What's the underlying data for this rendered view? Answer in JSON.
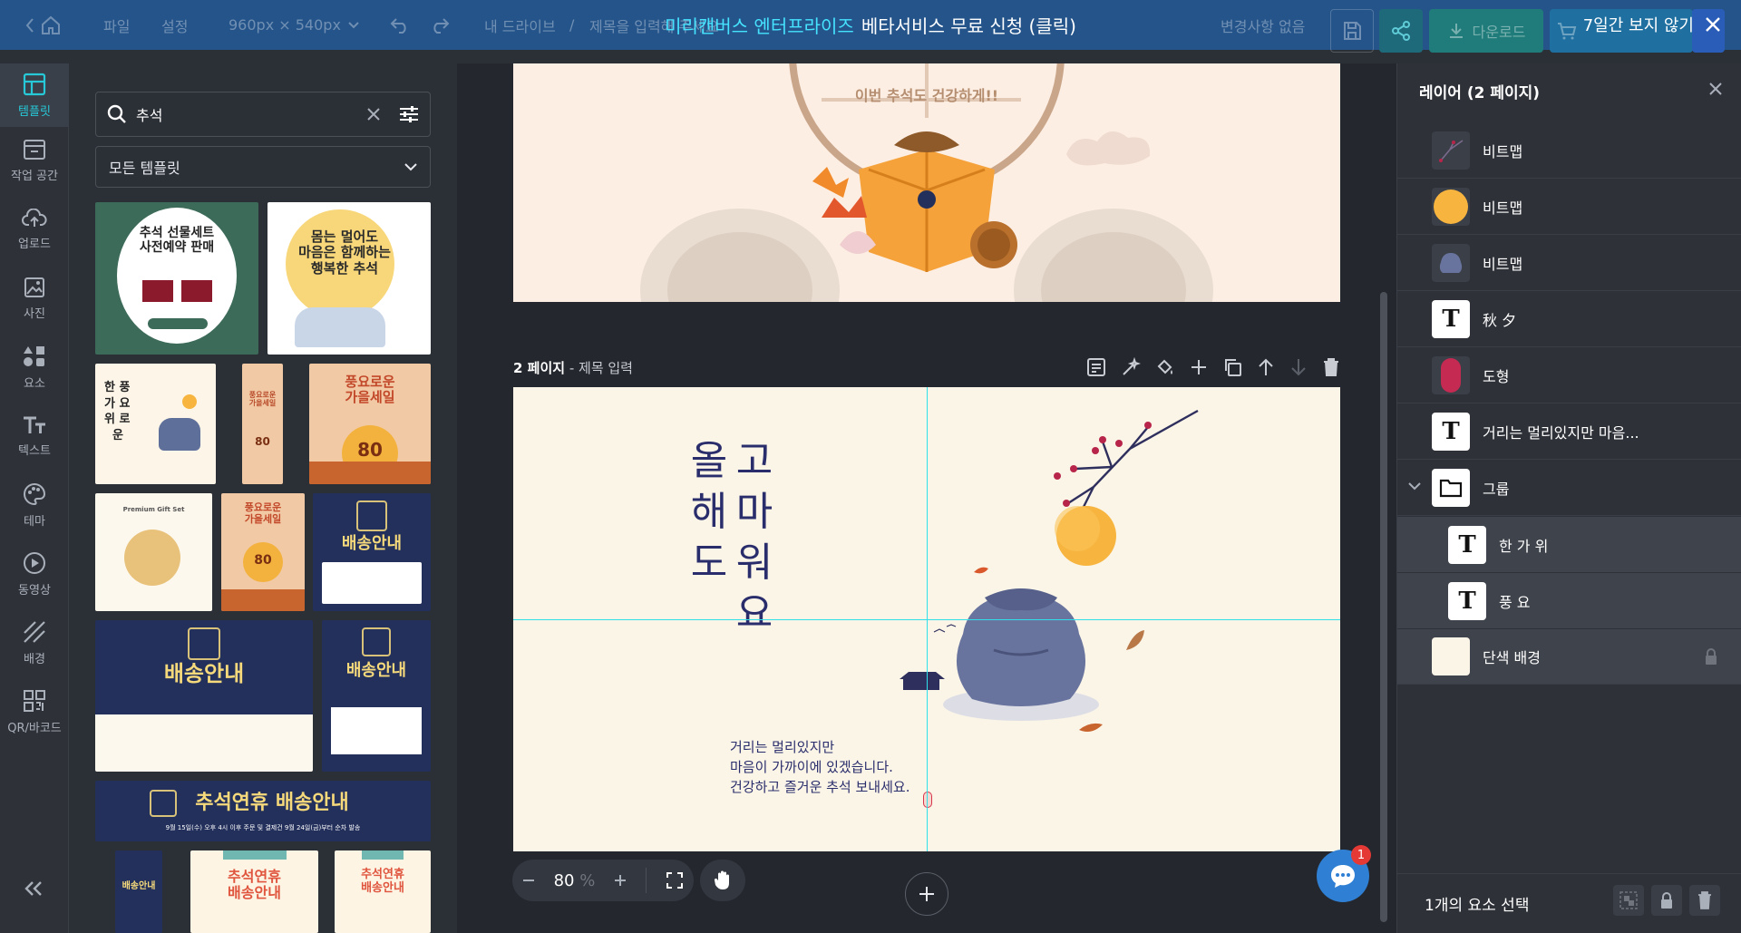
{
  "topbar": {
    "home_label": "",
    "menu_file": "파일",
    "menu_settings": "설정",
    "size": "960px × 540px",
    "breadcrumb_drive": "내 드라이브",
    "breadcrumb_sep": "/",
    "title_placeholder": "제목을 입력해 주세요",
    "no_changes": "변경사항 없음",
    "download_label": "다운로드",
    "banner_highlight": "미리캔버스 엔터프라이즈",
    "banner_text": "베타서비스 무료 신청 (클릭)",
    "banner_dismiss": "7일간 보지 않기"
  },
  "rail": [
    {
      "label": "템플릿",
      "icon": "template-icon"
    },
    {
      "label": "작업 공간",
      "icon": "workspace-icon"
    },
    {
      "label": "업로드",
      "icon": "upload-icon"
    },
    {
      "label": "사진",
      "icon": "photo-icon"
    },
    {
      "label": "요소",
      "icon": "elements-icon"
    },
    {
      "label": "텍스트",
      "icon": "text-icon"
    },
    {
      "label": "테마",
      "icon": "theme-icon"
    },
    {
      "label": "동영상",
      "icon": "video-icon"
    },
    {
      "label": "배경",
      "icon": "background-icon"
    },
    {
      "label": "QR/바코드",
      "icon": "qr-icon"
    }
  ],
  "panel": {
    "search_value": "추석",
    "filter_label": "모든 템플릿",
    "templates": {
      "t1_title": "추석 선물세트\n사전예약 판매",
      "t2_title": "몸는 멀어도\n마음은 함께하는\n행복한 추석",
      "t3_title": "한 풍\n가 요\n위 로\n  운",
      "t4_title": "풍요로운\n가을세일",
      "t4_num": "80",
      "t5_title": "풍요로운\n가을세일",
      "t5_num": "80",
      "t6_label": "Premium Gift Set",
      "t7_title": "풍요로운\n가을세일",
      "t7_num": "80",
      "t8_title": "배송안내",
      "t9_title": "배송안내",
      "t10_title": "배송안내",
      "t11_title": "추석연휴 배송안내",
      "t11_sub": "9월 15일(수) 오후 4시 이후 주문 및 결제건 9월 24일(금)부터 순차 발송",
      "t12_title": "배송안내",
      "t13_title": "추석연휴\n배송안내",
      "t14_title": "추석연휴\n배송안내"
    }
  },
  "canvas": {
    "page1_text": "이번 추석도 건강하게!!",
    "page2_label": "2 페이지",
    "page2_sep": " - ",
    "page2_title_placeholder": "제목 입력",
    "col1": [
      "올",
      "해",
      "도"
    ],
    "col2": [
      "고",
      "마",
      "워",
      "요"
    ],
    "body_line1": "거리는 멀리있지만",
    "body_line2": "마음이 가까이에 있겠습니다.",
    "body_line3": "건강하고 즐거운 추석 보내세요."
  },
  "zoom": {
    "value": "80",
    "unit": "%"
  },
  "chat_badge": "1",
  "layers": {
    "title": "레이어 (2 페이지)",
    "items": [
      {
        "name": "비트맵",
        "kind": "bitmap-branch"
      },
      {
        "name": "비트맵",
        "kind": "bitmap-moon"
      },
      {
        "name": "비트맵",
        "kind": "bitmap-bundle"
      },
      {
        "name": "秋 夕",
        "kind": "text"
      },
      {
        "name": "도형",
        "kind": "shape"
      },
      {
        "name": "거리는 멀리있지만 마음...",
        "kind": "text"
      },
      {
        "name": "그룹",
        "kind": "group"
      },
      {
        "name": "한 가 위",
        "kind": "text-child"
      },
      {
        "name": "풍 요",
        "kind": "text-child"
      },
      {
        "name": "단색 배경",
        "kind": "background"
      }
    ],
    "text_glyph": "T",
    "footer": "1개의 요소 선택"
  },
  "colors": {
    "accent": "#27c8d8",
    "topbar": "#24548a",
    "navy_text": "#2a2d6b",
    "page2_bg": "#fbf5e8"
  }
}
